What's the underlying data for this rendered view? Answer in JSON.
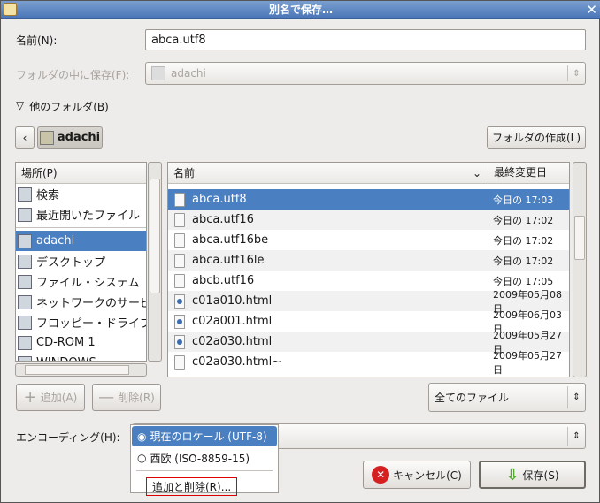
{
  "window": {
    "title": "別名で保存…"
  },
  "name_label": "名前(N):",
  "name_value": "abca.utf8",
  "folder_label": "フォルダの中に保存(F):",
  "folder_value": "adachi",
  "other_folder": "他のフォルダ(B)",
  "path": {
    "current": "adachi"
  },
  "create_folder": "フォルダの作成(L)",
  "places": {
    "header": "場所(P)",
    "items": [
      {
        "label": "検索",
        "icon": "binoculars-icon"
      },
      {
        "label": "最近開いたファイル",
        "icon": "recent-icon"
      },
      {
        "label": "adachi",
        "icon": "home-folder-icon",
        "selected": true
      },
      {
        "label": "デスクトップ",
        "icon": "desktop-icon"
      },
      {
        "label": "ファイル・システム",
        "icon": "drive-icon"
      },
      {
        "label": "ネットワークのサービス",
        "icon": "network-icon"
      },
      {
        "label": "フロッピー・ドライブ",
        "icon": "floppy-icon"
      },
      {
        "label": "CD-ROM 1",
        "icon": "cdrom-icon"
      },
      {
        "label": "WINDOWS",
        "icon": "drive-icon"
      }
    ]
  },
  "files": {
    "col_name": "名前",
    "col_modified": "最終変更日",
    "rows": [
      {
        "name": "abca.utf8",
        "modified": "今日の 17:03",
        "type": "text",
        "selected": true
      },
      {
        "name": "abca.utf16",
        "modified": "今日の 17:02",
        "type": "text"
      },
      {
        "name": "abca.utf16be",
        "modified": "今日の 17:02",
        "type": "text"
      },
      {
        "name": "abca.utf16le",
        "modified": "今日の 17:02",
        "type": "text"
      },
      {
        "name": "abcb.utf16",
        "modified": "今日の 17:05",
        "type": "text"
      },
      {
        "name": "c01a010.html",
        "modified": "2009年05月08日",
        "type": "html"
      },
      {
        "name": "c02a001.html",
        "modified": "2009年06月03日",
        "type": "html"
      },
      {
        "name": "c02a030.html",
        "modified": "2009年05月27日",
        "type": "html"
      },
      {
        "name": "c02a030.html~",
        "modified": "2009年05月27日",
        "type": "text"
      }
    ]
  },
  "add_button": "追加(A)",
  "remove_button": "削除(R)",
  "filter": "全てのファイル",
  "encoding": {
    "label": "エンコーディング(H):",
    "options": [
      "現在のロケール (UTF-8)",
      "西欧 (ISO-8859-15)"
    ],
    "selected": 0,
    "manage": "追加と削除(R)..."
  },
  "cancel_button": "キャンセル(C)",
  "save_button": "保存(S)"
}
